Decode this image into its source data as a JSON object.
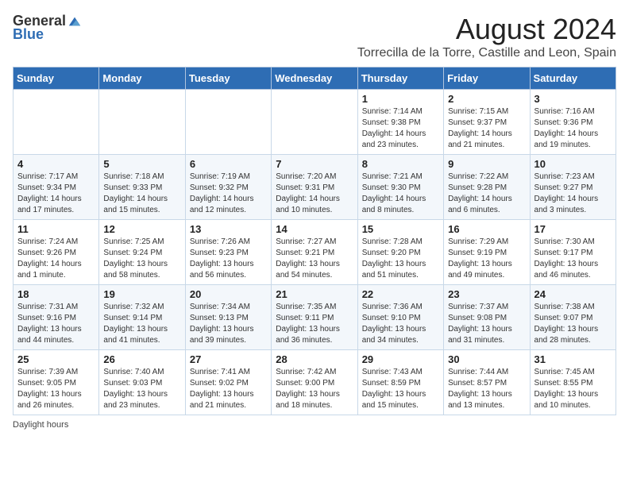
{
  "logo": {
    "text_general": "General",
    "text_blue": "Blue"
  },
  "title": "August 2024",
  "subtitle": "Torrecilla de la Torre, Castille and Leon, Spain",
  "days_of_week": [
    "Sunday",
    "Monday",
    "Tuesday",
    "Wednesday",
    "Thursday",
    "Friday",
    "Saturday"
  ],
  "weeks": [
    [
      {
        "day": "",
        "info": ""
      },
      {
        "day": "",
        "info": ""
      },
      {
        "day": "",
        "info": ""
      },
      {
        "day": "",
        "info": ""
      },
      {
        "day": "1",
        "info": "Sunrise: 7:14 AM\nSunset: 9:38 PM\nDaylight: 14 hours and 23 minutes."
      },
      {
        "day": "2",
        "info": "Sunrise: 7:15 AM\nSunset: 9:37 PM\nDaylight: 14 hours and 21 minutes."
      },
      {
        "day": "3",
        "info": "Sunrise: 7:16 AM\nSunset: 9:36 PM\nDaylight: 14 hours and 19 minutes."
      }
    ],
    [
      {
        "day": "4",
        "info": "Sunrise: 7:17 AM\nSunset: 9:34 PM\nDaylight: 14 hours and 17 minutes."
      },
      {
        "day": "5",
        "info": "Sunrise: 7:18 AM\nSunset: 9:33 PM\nDaylight: 14 hours and 15 minutes."
      },
      {
        "day": "6",
        "info": "Sunrise: 7:19 AM\nSunset: 9:32 PM\nDaylight: 14 hours and 12 minutes."
      },
      {
        "day": "7",
        "info": "Sunrise: 7:20 AM\nSunset: 9:31 PM\nDaylight: 14 hours and 10 minutes."
      },
      {
        "day": "8",
        "info": "Sunrise: 7:21 AM\nSunset: 9:30 PM\nDaylight: 14 hours and 8 minutes."
      },
      {
        "day": "9",
        "info": "Sunrise: 7:22 AM\nSunset: 9:28 PM\nDaylight: 14 hours and 6 minutes."
      },
      {
        "day": "10",
        "info": "Sunrise: 7:23 AM\nSunset: 9:27 PM\nDaylight: 14 hours and 3 minutes."
      }
    ],
    [
      {
        "day": "11",
        "info": "Sunrise: 7:24 AM\nSunset: 9:26 PM\nDaylight: 14 hours and 1 minute."
      },
      {
        "day": "12",
        "info": "Sunrise: 7:25 AM\nSunset: 9:24 PM\nDaylight: 13 hours and 58 minutes."
      },
      {
        "day": "13",
        "info": "Sunrise: 7:26 AM\nSunset: 9:23 PM\nDaylight: 13 hours and 56 minutes."
      },
      {
        "day": "14",
        "info": "Sunrise: 7:27 AM\nSunset: 9:21 PM\nDaylight: 13 hours and 54 minutes."
      },
      {
        "day": "15",
        "info": "Sunrise: 7:28 AM\nSunset: 9:20 PM\nDaylight: 13 hours and 51 minutes."
      },
      {
        "day": "16",
        "info": "Sunrise: 7:29 AM\nSunset: 9:19 PM\nDaylight: 13 hours and 49 minutes."
      },
      {
        "day": "17",
        "info": "Sunrise: 7:30 AM\nSunset: 9:17 PM\nDaylight: 13 hours and 46 minutes."
      }
    ],
    [
      {
        "day": "18",
        "info": "Sunrise: 7:31 AM\nSunset: 9:16 PM\nDaylight: 13 hours and 44 minutes."
      },
      {
        "day": "19",
        "info": "Sunrise: 7:32 AM\nSunset: 9:14 PM\nDaylight: 13 hours and 41 minutes."
      },
      {
        "day": "20",
        "info": "Sunrise: 7:34 AM\nSunset: 9:13 PM\nDaylight: 13 hours and 39 minutes."
      },
      {
        "day": "21",
        "info": "Sunrise: 7:35 AM\nSunset: 9:11 PM\nDaylight: 13 hours and 36 minutes."
      },
      {
        "day": "22",
        "info": "Sunrise: 7:36 AM\nSunset: 9:10 PM\nDaylight: 13 hours and 34 minutes."
      },
      {
        "day": "23",
        "info": "Sunrise: 7:37 AM\nSunset: 9:08 PM\nDaylight: 13 hours and 31 minutes."
      },
      {
        "day": "24",
        "info": "Sunrise: 7:38 AM\nSunset: 9:07 PM\nDaylight: 13 hours and 28 minutes."
      }
    ],
    [
      {
        "day": "25",
        "info": "Sunrise: 7:39 AM\nSunset: 9:05 PM\nDaylight: 13 hours and 26 minutes."
      },
      {
        "day": "26",
        "info": "Sunrise: 7:40 AM\nSunset: 9:03 PM\nDaylight: 13 hours and 23 minutes."
      },
      {
        "day": "27",
        "info": "Sunrise: 7:41 AM\nSunset: 9:02 PM\nDaylight: 13 hours and 21 minutes."
      },
      {
        "day": "28",
        "info": "Sunrise: 7:42 AM\nSunset: 9:00 PM\nDaylight: 13 hours and 18 minutes."
      },
      {
        "day": "29",
        "info": "Sunrise: 7:43 AM\nSunset: 8:59 PM\nDaylight: 13 hours and 15 minutes."
      },
      {
        "day": "30",
        "info": "Sunrise: 7:44 AM\nSunset: 8:57 PM\nDaylight: 13 hours and 13 minutes."
      },
      {
        "day": "31",
        "info": "Sunrise: 7:45 AM\nSunset: 8:55 PM\nDaylight: 13 hours and 10 minutes."
      }
    ]
  ],
  "footer": "Daylight hours"
}
